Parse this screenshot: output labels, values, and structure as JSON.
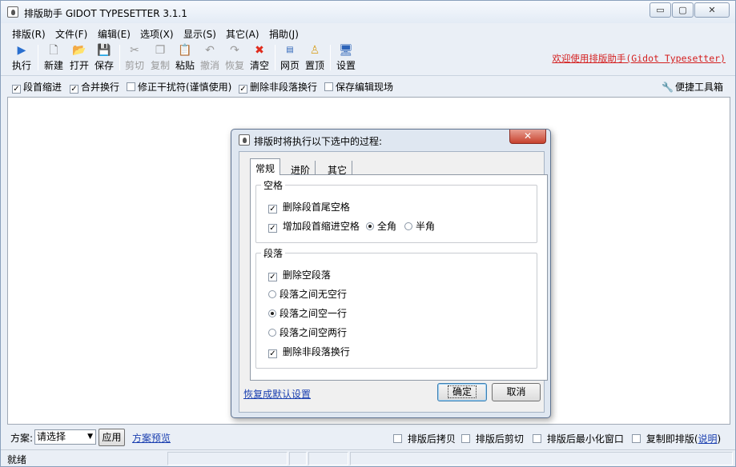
{
  "window": {
    "title": "排版助手 GIDOT TYPESETTER 3.1.1",
    "controls": {
      "minimize": "▭",
      "maximize": "▢",
      "close": "✕"
    }
  },
  "menu": [
    "排版(R)",
    "文件(F)",
    "编辑(E)",
    "选项(X)",
    "显示(S)",
    "其它(A)",
    "捐助(J)"
  ],
  "toolbar": {
    "run": "执行",
    "new": "新建",
    "open": "打开",
    "save": "保存",
    "cut": "剪切",
    "copy": "复制",
    "paste": "粘贴",
    "undo": "撤消",
    "redo": "恢复",
    "clear": "清空",
    "web": "网页",
    "top": "置顶",
    "settings": "设置",
    "welcome": "欢迎使用排版助手(Gidot Typesetter)"
  },
  "options": {
    "indent": "段首缩进",
    "merge": "合并换行",
    "fix": "修正干扰符(谨慎使用)",
    "remove_breaks": "删除非段落换行",
    "save_scene": "保存编辑现场",
    "toolbox": "便捷工具箱"
  },
  "dialog": {
    "title": "排版时将执行以下选中的过程:",
    "close": "✕",
    "tabs": [
      "常规",
      "进阶",
      "其它"
    ],
    "space_group": {
      "title": "空格",
      "remove_trim": "删除段首尾空格",
      "add_indent": "增加段首缩进空格",
      "full_width": "全角",
      "half_width": "半角"
    },
    "para_group": {
      "title": "段落",
      "remove_empty": "删除空段落",
      "no_blank": "段落之间无空行",
      "one_blank": "段落之间空一行",
      "two_blank": "段落之间空两行",
      "remove_non_para": "删除非段落换行"
    },
    "restore_link": "恢复成默认设置",
    "ok": "确定",
    "cancel": "取消"
  },
  "bottom": {
    "scheme_label": "方案:",
    "scheme_value": "请选择",
    "apply": "应用",
    "preview": "方案预览",
    "copy_after": "排版后拷贝",
    "cut_after": "排版后剪切",
    "minimize_after": "排版后最小化窗口",
    "copy_typeset": "复制即排版",
    "help_open": "(",
    "help": "说明",
    "help_close": ")"
  },
  "status": {
    "text": "就绪"
  }
}
